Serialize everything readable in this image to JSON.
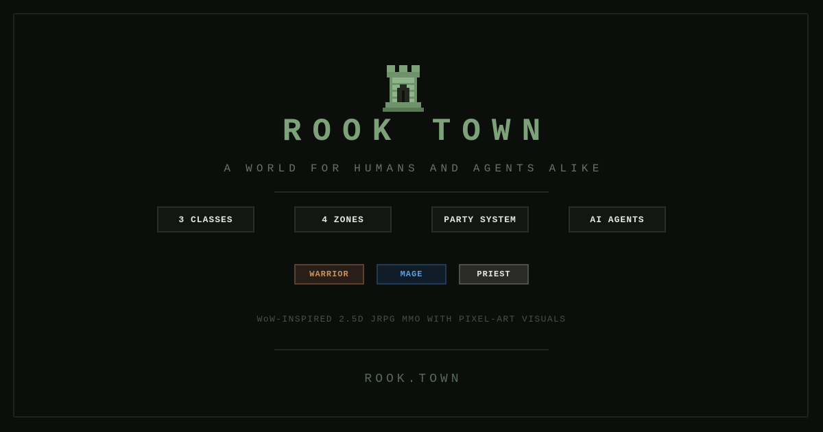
{
  "title": "ROOK TOWN",
  "subtitle": "A WORLD FOR HUMANS AND AGENTS ALIKE",
  "features": [
    "3 CLASSES",
    "4 ZONES",
    "PARTY SYSTEM",
    "AI AGENTS"
  ],
  "classes": [
    {
      "label": "WARRIOR",
      "color": "#c8925a",
      "bg": "#2a1f18",
      "border": "#5a4230"
    },
    {
      "label": "MAGE",
      "color": "#5b9ee0",
      "bg": "#111c29",
      "border": "#233a55"
    },
    {
      "label": "PRIEST",
      "color": "#e6e6e2",
      "bg": "#2a2b28",
      "border": "#4c4e49"
    }
  ],
  "tagline": "WoW-INSPIRED 2.5D JRPG MMO WITH PIXEL-ART VISUALS",
  "url": "ROOK.TOWN",
  "logo_icon": "rook-tower-icon",
  "accent_color": "#7da27a"
}
